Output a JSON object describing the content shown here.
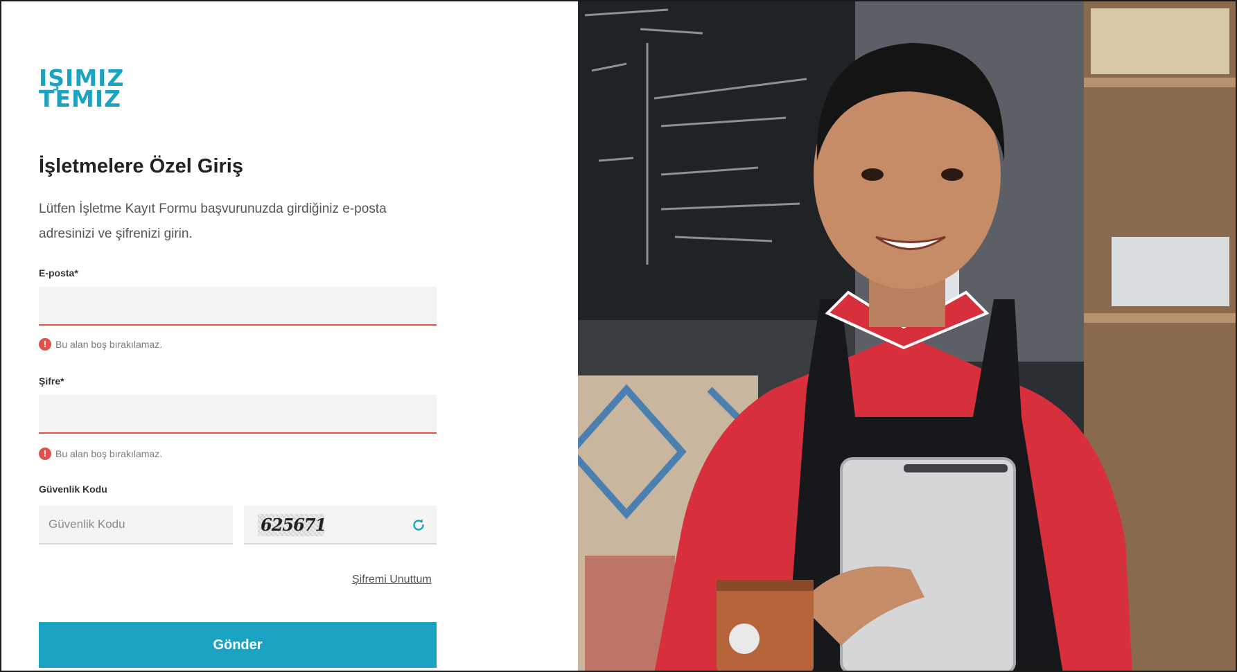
{
  "brand": {
    "logo_line1": "IŞIMIZ",
    "logo_line2": "TEMIZ",
    "color": "#1aa3c2"
  },
  "login": {
    "title": "İşletmelere Özel Giriş",
    "description": "Lütfen İşletme Kayıt Formu başvurunuzda girdiğiniz e-posta adresinizi ve şifrenizi girin.",
    "email": {
      "label": "E-posta*",
      "value": "",
      "error": "Bu alan boş bırakılamaz."
    },
    "password": {
      "label": "Şifre*",
      "value": "",
      "error": "Bu alan boş bırakılamaz."
    },
    "captcha": {
      "label": "Güvenlik Kodu",
      "placeholder": "Güvenlik Kodu",
      "value": "",
      "code": "625671"
    },
    "forgot_password": "Şifremi Unuttum",
    "submit": "Gönder"
  },
  "colors": {
    "accent": "#1aa3c2",
    "error": "#e0524a",
    "input_bg": "#f4f4f4"
  },
  "icons": {
    "error": "exclamation-circle-icon",
    "refresh": "refresh-icon"
  }
}
